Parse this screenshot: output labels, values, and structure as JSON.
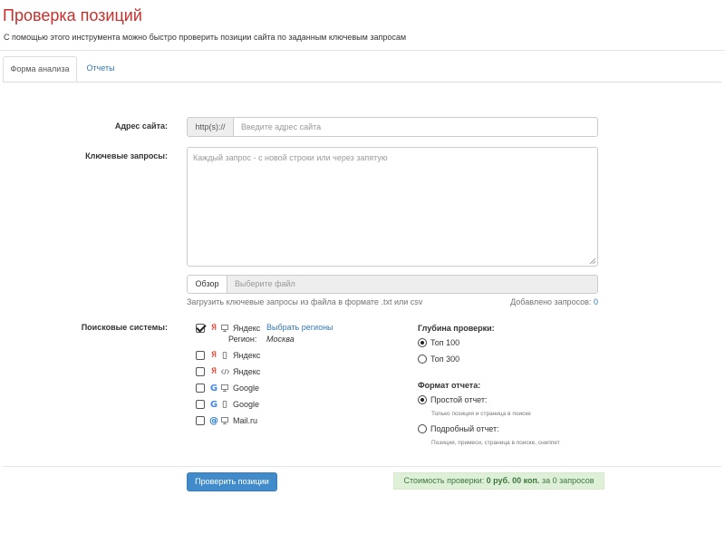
{
  "header": {
    "title": "Проверка позиций",
    "subtitle": "С помощью этого инструмента можно быстро проверить позиции сайта по заданным ключевым запросам"
  },
  "tabs": [
    {
      "label": "Форма анализа",
      "active": true
    },
    {
      "label": "Отчеты",
      "active": false
    }
  ],
  "form": {
    "site": {
      "label": "Адрес сайта:",
      "prefix": "http(s)://",
      "placeholder": "Введите адрес сайта",
      "value": ""
    },
    "queries": {
      "label": "Ключевые запросы:",
      "placeholder": "Каждый запрос - с новой строки или через запятую",
      "value": ""
    },
    "file": {
      "browse_label": "Обзор",
      "placeholder": "Выберите файл",
      "help": "Загрузить ключевые запросы из файла в формате .txt или csv",
      "added_label": "Добавлено запросов:",
      "added_count": "0"
    },
    "search_engines": {
      "label": "Поисковые системы:",
      "items": [
        {
          "engine_icon": "yandex-icon",
          "device_icon": "desktop-icon",
          "name": "Яндекс",
          "checked": true
        },
        {
          "engine_icon": "yandex-icon",
          "device_icon": "mobile-icon",
          "name": "Яндекс",
          "checked": false
        },
        {
          "engine_icon": "yandex-icon",
          "device_icon": "code-icon",
          "name": "Яндекс",
          "checked": false
        },
        {
          "engine_icon": "google-icon",
          "device_icon": "desktop-icon",
          "name": "Google",
          "checked": false
        },
        {
          "engine_icon": "google-icon",
          "device_icon": "mobile-icon",
          "name": "Google",
          "checked": false
        },
        {
          "engine_icon": "mailru-icon",
          "device_icon": "desktop-icon",
          "name": "Mail.ru",
          "checked": false
        }
      ],
      "region_link": "Выбрать регионы",
      "region_label": "Регион:",
      "region_value": "Москва"
    },
    "depth": {
      "title": "Глубина проверки:",
      "options": [
        {
          "label": "Топ 100",
          "selected": true
        },
        {
          "label": "Топ 300",
          "selected": false
        }
      ]
    },
    "report_format": {
      "title": "Формат отчета:",
      "options": [
        {
          "label": "Простой отчет:",
          "hint": "Только позиция и страница в поиске",
          "selected": true
        },
        {
          "label": "Подробный отчет:",
          "hint": "Позиция, примеси, страница в поиске, сниппет",
          "selected": false
        }
      ]
    }
  },
  "footer": {
    "submit_label": "Проверить позиции",
    "cost_prefix": "Стоимость проверки:",
    "cost_value": "0 руб. 00 коп.",
    "cost_suffix": "за 0 запросов"
  },
  "colors": {
    "title": "#c9302c",
    "link": "#337ab7",
    "primary_button": "#428bca",
    "success_bg": "#dff0d8",
    "success_text": "#3c763d"
  }
}
